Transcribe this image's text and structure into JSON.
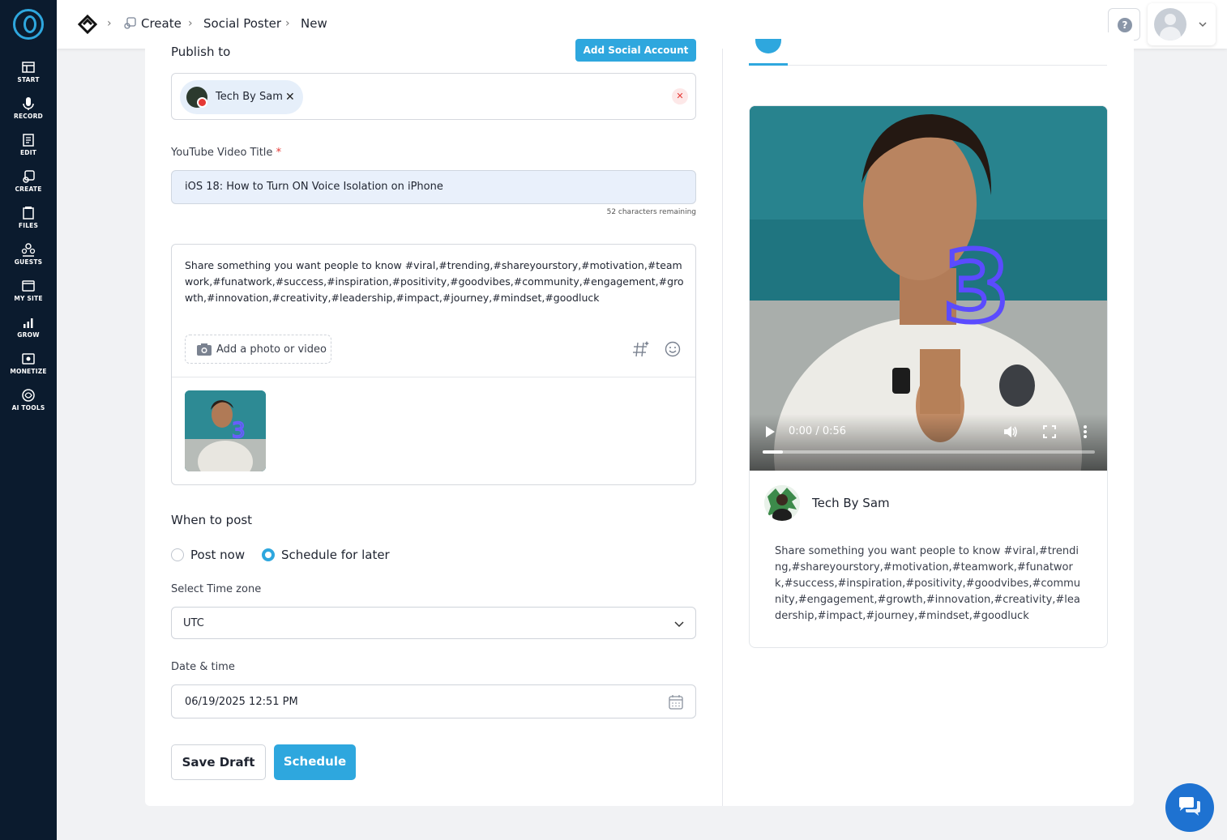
{
  "sidebar": {
    "items": [
      {
        "label": "START",
        "icon": "start-icon"
      },
      {
        "label": "RECORD",
        "icon": "microphone-icon"
      },
      {
        "label": "EDIT",
        "icon": "edit-icon"
      },
      {
        "label": "CREATE",
        "icon": "create-icon"
      },
      {
        "label": "FILES",
        "icon": "files-icon"
      },
      {
        "label": "GUESTS",
        "icon": "guests-icon"
      },
      {
        "label": "MY SITE",
        "icon": "my-site-icon"
      },
      {
        "label": "GROW",
        "icon": "grow-icon"
      },
      {
        "label": "MONETIZE",
        "icon": "monetize-icon"
      },
      {
        "label": "AI TOOLS",
        "icon": "ai-tools-icon"
      }
    ]
  },
  "breadcrumb": {
    "items": [
      "Create",
      "Social Poster",
      "New"
    ]
  },
  "publish": {
    "title": "Publish to",
    "add_account_label": "Add Social Account",
    "account_chip": "Tech By Sam"
  },
  "video_title": {
    "label": "YouTube Video Title",
    "required_mark": "*",
    "value": "iOS 18: How to Turn ON Voice Isolation on iPhone",
    "chars_remaining": "52 characters remaining"
  },
  "description": {
    "text": "Share something you want people to know #viral,#trending,#shareyourstory,#motivation,#teamwork,#funatwork,#success,#inspiration,#positivity,#goodvibes,#community,#engagement,#growth,#innovation,#creativity,#leadership,#impact,#journey,#mindset,#goodluck",
    "add_media_label": "Add a photo or video"
  },
  "when_to_post": {
    "title": "When to post",
    "options": [
      {
        "label": "Post now",
        "selected": false
      },
      {
        "label": "Schedule for later",
        "selected": true
      }
    ]
  },
  "timezone": {
    "label": "Select Time zone",
    "value": "UTC"
  },
  "datetime": {
    "label": "Date & time",
    "value": "06/19/2025 12:51 PM"
  },
  "actions": {
    "save_draft": "Save Draft",
    "schedule": "Schedule"
  },
  "preview": {
    "time": "0:00 / 0:56",
    "progress": 0.06,
    "account_name": "Tech By Sam",
    "text": "Share something you want people to know #viral,#trending,#shareyourstory,#motivation,#teamwork,#funatwork,#success,#inspiration,#positivity,#goodvibes,#community,#engagement,#growth,#innovation,#creativity,#leadership,#impact,#journey,#mindset,#goodluck"
  },
  "header": {
    "help_label": "?"
  },
  "colors": {
    "accent": "#2ea7de",
    "sidebar": "#0b1b2e",
    "chat": "#1e72d1"
  }
}
